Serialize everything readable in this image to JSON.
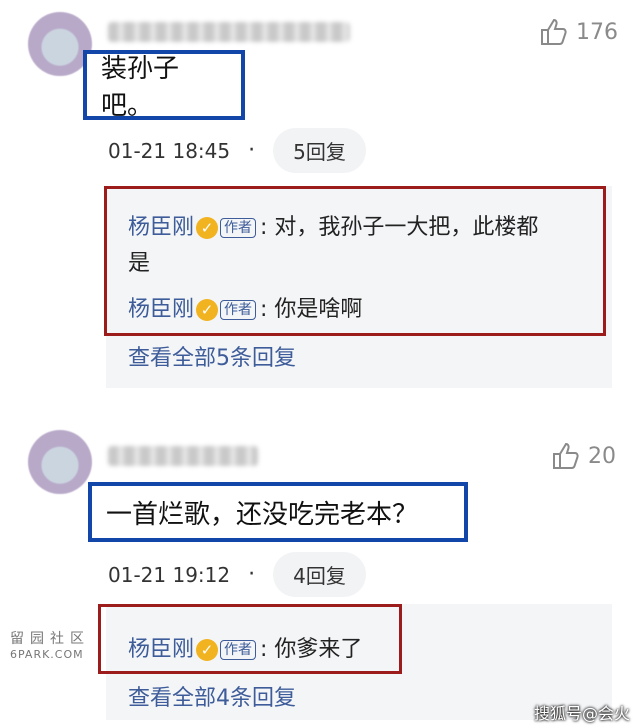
{
  "comments": [
    {
      "likes": "176",
      "text": "装孙子吧。",
      "timestamp": "01-21 18:45",
      "dot": "·",
      "reply_count": "5回复",
      "replies": [
        {
          "author": "杨臣刚",
          "badge": "作者",
          "text_line1": ": 对，我孙子一大把，此楼都",
          "text_line2": "是"
        },
        {
          "author": "杨臣刚",
          "badge": "作者",
          "text_line1": ": 你是啥啊"
        }
      ],
      "view_all": "查看全部5条回复"
    },
    {
      "likes": "20",
      "text": "一首烂歌，还没吃完老本？",
      "timestamp": "01-21 19:12",
      "dot": "·",
      "reply_count": "4回复",
      "replies": [
        {
          "author": "杨臣刚",
          "badge": "作者",
          "text_line1": ": 你爹来了"
        }
      ],
      "view_all": "查看全部4条回复"
    }
  ],
  "watermark_left_line1": "留园社区",
  "watermark_left_line2": "6PARK.COM",
  "watermark_right": "搜狐号@会火",
  "colors": {
    "author": "#3d5c99",
    "blue_box": "#1246a8",
    "red_box": "#9c1c1c"
  }
}
